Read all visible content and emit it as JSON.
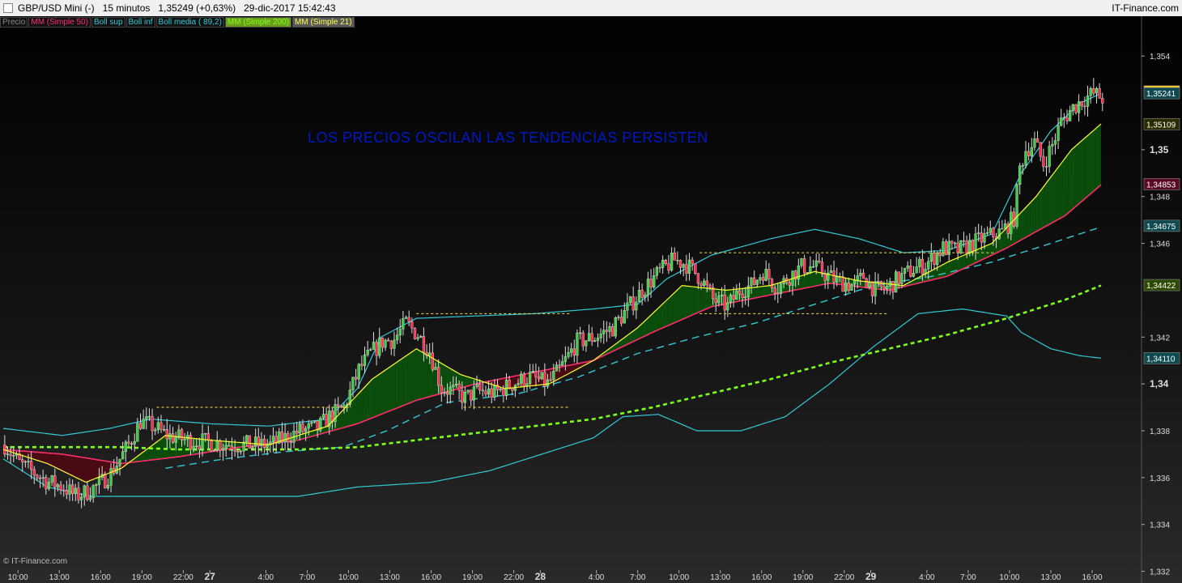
{
  "titlebar": {
    "text": "GBP/USD Mini (-)   15 minutos   1,35249 (+0,63%)   29-dic-2017 15:42:43",
    "brand": "IT-Finance.com"
  },
  "legend": [
    {
      "label": "Precio",
      "color": "#8a8a8a",
      "style": ""
    },
    {
      "label": "MM (Simple 50)",
      "color": "#ff2d7a",
      "style": ""
    },
    {
      "label": "Boll sup",
      "color": "#33c9d6",
      "style": ""
    },
    {
      "label": "Boll inf",
      "color": "#33c9d6",
      "style": ""
    },
    {
      "label": "Boll media ( 89,2)",
      "color": "#33c9d6",
      "style": ""
    },
    {
      "label": "MM (Simple 200)",
      "color": "#7dff1a",
      "style": "hi"
    },
    {
      "label": "MM (Simple 21)",
      "color": "#ffff4d",
      "style": "active"
    }
  ],
  "annotation": "LOS PRECIOS OSCILAN  LAS TENDENCIAS PERSISTEN",
  "watermark": "© IT-Finance.com",
  "chart_data": {
    "type": "candlestick",
    "symbol": "GBP/USD Mini",
    "timeframe": "15 minutos",
    "ylim": [
      1.3315,
      1.3557
    ],
    "x_range_bars": [
      0,
      361
    ],
    "y_ticks": [
      {
        "v": 1.354,
        "label": "1,354",
        "bold": false
      },
      {
        "v": 1.35,
        "label": "1,35",
        "bold": true
      },
      {
        "v": 1.348,
        "label": "1,348",
        "bold": false
      },
      {
        "v": 1.346,
        "label": "1,346",
        "bold": false
      },
      {
        "v": 1.342,
        "label": "1,342",
        "bold": false
      },
      {
        "v": 1.34,
        "label": "1,34",
        "bold": true
      },
      {
        "v": 1.338,
        "label": "1,338",
        "bold": false
      },
      {
        "v": 1.336,
        "label": "1,336",
        "bold": false
      },
      {
        "v": 1.334,
        "label": "1,334",
        "bold": false
      },
      {
        "v": 1.332,
        "label": "1,332",
        "bold": false
      }
    ],
    "x_ticks": [
      {
        "bar": 5,
        "label": "10:00",
        "bold": false
      },
      {
        "bar": 19,
        "label": "13:00",
        "bold": false
      },
      {
        "bar": 33,
        "label": "16:00",
        "bold": false
      },
      {
        "bar": 47,
        "label": "19:00",
        "bold": false
      },
      {
        "bar": 61,
        "label": "22:00",
        "bold": false
      },
      {
        "bar": 70,
        "label": "27",
        "bold": true
      },
      {
        "bar": 89,
        "label": "4:00",
        "bold": false
      },
      {
        "bar": 103,
        "label": "7:00",
        "bold": false
      },
      {
        "bar": 117,
        "label": "10:00",
        "bold": false
      },
      {
        "bar": 131,
        "label": "13:00",
        "bold": false
      },
      {
        "bar": 145,
        "label": "16:00",
        "bold": false
      },
      {
        "bar": 159,
        "label": "19:00",
        "bold": false
      },
      {
        "bar": 173,
        "label": "22:00",
        "bold": false
      },
      {
        "bar": 182,
        "label": "28",
        "bold": true
      },
      {
        "bar": 201,
        "label": "4:00",
        "bold": false
      },
      {
        "bar": 215,
        "label": "7:00",
        "bold": false
      },
      {
        "bar": 229,
        "label": "10:00",
        "bold": false
      },
      {
        "bar": 243,
        "label": "13:00",
        "bold": false
      },
      {
        "bar": 257,
        "label": "16:00",
        "bold": false
      },
      {
        "bar": 271,
        "label": "19:00",
        "bold": false
      },
      {
        "bar": 285,
        "label": "22:00",
        "bold": false
      },
      {
        "bar": 294,
        "label": "29",
        "bold": true
      },
      {
        "bar": 313,
        "label": "4:00",
        "bold": false
      },
      {
        "bar": 327,
        "label": "7:00",
        "bold": false
      },
      {
        "bar": 341,
        "label": "10:00",
        "bold": false
      },
      {
        "bar": 355,
        "label": "13:00",
        "bold": false
      },
      {
        "bar": 369,
        "label": "16:00",
        "bold": false
      }
    ],
    "price_tags": [
      {
        "v": 1.35249,
        "label": "1,35249",
        "bg": "#ffd21f",
        "fg": "#000",
        "note": "last price"
      },
      {
        "v": 1.35241,
        "label": "1,35241",
        "bg": "#0e4a4f",
        "fg": "#fff",
        "note": "Boll sup"
      },
      {
        "v": 1.35109,
        "label": "1,35109",
        "bg": "#2b2b00",
        "fg": "#fff",
        "note": "MM 21"
      },
      {
        "v": 1.34853,
        "label": "1,34853",
        "bg": "#5a0a22",
        "fg": "#fff",
        "note": "MM 50"
      },
      {
        "v": 1.34675,
        "label": "1,34675",
        "bg": "#0e4a4f",
        "fg": "#fff",
        "note": "Boll media"
      },
      {
        "v": 1.34422,
        "label": "1,34422",
        "bg": "#2a4a00",
        "fg": "#fff",
        "note": "MM 200"
      },
      {
        "v": 1.3411,
        "label": "1,34110",
        "bg": "#0e4a4f",
        "fg": "#fff",
        "note": "Boll inf"
      }
    ],
    "price_anchors": [
      [
        0,
        1.3374
      ],
      [
        5,
        1.3366
      ],
      [
        10,
        1.3362
      ],
      [
        15,
        1.3358
      ],
      [
        20,
        1.3356
      ],
      [
        24,
        1.3352
      ],
      [
        28,
        1.3354
      ],
      [
        32,
        1.3357
      ],
      [
        36,
        1.3362
      ],
      [
        42,
        1.3374
      ],
      [
        46,
        1.3384
      ],
      [
        50,
        1.3382
      ],
      [
        55,
        1.3378
      ],
      [
        62,
        1.3376
      ],
      [
        70,
        1.3375
      ],
      [
        78,
        1.3374
      ],
      [
        84,
        1.3374
      ],
      [
        90,
        1.3374
      ],
      [
        95,
        1.3377
      ],
      [
        100,
        1.338
      ],
      [
        106,
        1.3381
      ],
      [
        110,
        1.3386
      ],
      [
        115,
        1.339
      ],
      [
        120,
        1.3406
      ],
      [
        124,
        1.3413
      ],
      [
        128,
        1.3418
      ],
      [
        132,
        1.3419
      ],
      [
        136,
        1.3426
      ],
      [
        140,
        1.3421
      ],
      [
        144,
        1.3414
      ],
      [
        148,
        1.3398
      ],
      [
        152,
        1.3397
      ],
      [
        156,
        1.3394
      ],
      [
        160,
        1.3397
      ],
      [
        166,
        1.3396
      ],
      [
        172,
        1.34
      ],
      [
        178,
        1.3403
      ],
      [
        184,
        1.34
      ],
      [
        188,
        1.3406
      ],
      [
        194,
        1.3418
      ],
      [
        200,
        1.342
      ],
      [
        206,
        1.3424
      ],
      [
        211,
        1.3432
      ],
      [
        216,
        1.344
      ],
      [
        222,
        1.3448
      ],
      [
        227,
        1.3453
      ],
      [
        231,
        1.3451
      ],
      [
        236,
        1.3445
      ],
      [
        240,
        1.3436
      ],
      [
        245,
        1.3433
      ],
      [
        249,
        1.344
      ],
      [
        253,
        1.3442
      ],
      [
        257,
        1.3448
      ],
      [
        262,
        1.3441
      ],
      [
        266,
        1.3446
      ],
      [
        270,
        1.345
      ],
      [
        274,
        1.345
      ],
      [
        278,
        1.3447
      ],
      [
        282,
        1.3444
      ],
      [
        288,
        1.3442
      ],
      [
        291,
        1.3446
      ],
      [
        295,
        1.344
      ],
      [
        299,
        1.3441
      ],
      [
        303,
        1.3445
      ],
      [
        308,
        1.3449
      ],
      [
        312,
        1.3451
      ],
      [
        318,
        1.3458
      ],
      [
        323,
        1.3457
      ],
      [
        328,
        1.346
      ],
      [
        333,
        1.3463
      ],
      [
        338,
        1.3465
      ],
      [
        342,
        1.3471
      ],
      [
        344,
        1.3492
      ],
      [
        346,
        1.35
      ],
      [
        349,
        1.3503
      ],
      [
        352,
        1.3494
      ],
      [
        355,
        1.3502
      ],
      [
        358,
        1.3512
      ],
      [
        362,
        1.3518
      ],
      [
        366,
        1.3522
      ],
      [
        369,
        1.3524
      ],
      [
        372,
        1.3522
      ]
    ],
    "sma50_anchors": [
      [
        0,
        1.3372
      ],
      [
        20,
        1.337
      ],
      [
        40,
        1.3366
      ],
      [
        60,
        1.3369
      ],
      [
        80,
        1.3373
      ],
      [
        100,
        1.3376
      ],
      [
        120,
        1.3383
      ],
      [
        140,
        1.3393
      ],
      [
        160,
        1.34
      ],
      [
        180,
        1.3405
      ],
      [
        200,
        1.341
      ],
      [
        220,
        1.3422
      ],
      [
        240,
        1.3433
      ],
      [
        260,
        1.3438
      ],
      [
        280,
        1.3443
      ],
      [
        300,
        1.344
      ],
      [
        320,
        1.3446
      ],
      [
        340,
        1.3458
      ],
      [
        360,
        1.3472
      ],
      [
        372,
        1.3485
      ]
    ],
    "sma21_anchors": [
      [
        0,
        1.3372
      ],
      [
        15,
        1.3366
      ],
      [
        28,
        1.3358
      ],
      [
        40,
        1.3364
      ],
      [
        55,
        1.3378
      ],
      [
        70,
        1.3376
      ],
      [
        90,
        1.3374
      ],
      [
        110,
        1.3382
      ],
      [
        125,
        1.3402
      ],
      [
        140,
        1.3415
      ],
      [
        155,
        1.3404
      ],
      [
        170,
        1.3398
      ],
      [
        185,
        1.34
      ],
      [
        200,
        1.341
      ],
      [
        215,
        1.3424
      ],
      [
        230,
        1.3442
      ],
      [
        245,
        1.344
      ],
      [
        260,
        1.3442
      ],
      [
        275,
        1.3448
      ],
      [
        290,
        1.3444
      ],
      [
        305,
        1.3442
      ],
      [
        320,
        1.3452
      ],
      [
        335,
        1.346
      ],
      [
        350,
        1.348
      ],
      [
        362,
        1.35
      ],
      [
        372,
        1.3511
      ]
    ],
    "boll_mid_anchors": [
      [
        55,
        1.3364
      ],
      [
        75,
        1.3368
      ],
      [
        95,
        1.3371
      ],
      [
        115,
        1.3373
      ],
      [
        130,
        1.338
      ],
      [
        150,
        1.3392
      ],
      [
        175,
        1.3396
      ],
      [
        195,
        1.3403
      ],
      [
        215,
        1.3413
      ],
      [
        235,
        1.342
      ],
      [
        255,
        1.3426
      ],
      [
        275,
        1.3434
      ],
      [
        295,
        1.3442
      ],
      [
        315,
        1.3446
      ],
      [
        335,
        1.3452
      ],
      [
        355,
        1.346
      ],
      [
        372,
        1.3467
      ]
    ],
    "boll_up_anchors": [
      [
        0,
        1.3381
      ],
      [
        20,
        1.3378
      ],
      [
        36,
        1.3381
      ],
      [
        50,
        1.3385
      ],
      [
        70,
        1.3383
      ],
      [
        90,
        1.3382
      ],
      [
        110,
        1.3385
      ],
      [
        120,
        1.3398
      ],
      [
        128,
        1.342
      ],
      [
        140,
        1.3428
      ],
      [
        160,
        1.3429
      ],
      [
        180,
        1.343
      ],
      [
        200,
        1.3432
      ],
      [
        215,
        1.3434
      ],
      [
        225,
        1.3445
      ],
      [
        240,
        1.3455
      ],
      [
        260,
        1.3462
      ],
      [
        275,
        1.3466
      ],
      [
        290,
        1.3462
      ],
      [
        305,
        1.3456
      ],
      [
        320,
        1.3457
      ],
      [
        335,
        1.3464
      ],
      [
        345,
        1.349
      ],
      [
        355,
        1.3508
      ],
      [
        365,
        1.352
      ],
      [
        372,
        1.3524
      ]
    ],
    "boll_low_anchors": [
      [
        0,
        1.3368
      ],
      [
        15,
        1.3356
      ],
      [
        30,
        1.3352
      ],
      [
        50,
        1.3352
      ],
      [
        80,
        1.3352
      ],
      [
        100,
        1.3352
      ],
      [
        120,
        1.3356
      ],
      [
        145,
        1.3358
      ],
      [
        165,
        1.3363
      ],
      [
        185,
        1.3371
      ],
      [
        200,
        1.3377
      ],
      [
        210,
        1.3386
      ],
      [
        222,
        1.3387
      ],
      [
        235,
        1.338
      ],
      [
        250,
        1.338
      ],
      [
        265,
        1.3386
      ],
      [
        280,
        1.34
      ],
      [
        295,
        1.3416
      ],
      [
        310,
        1.343
      ],
      [
        325,
        1.3432
      ],
      [
        340,
        1.3429
      ],
      [
        345,
        1.3422
      ],
      [
        355,
        1.3415
      ],
      [
        365,
        1.3412
      ],
      [
        372,
        1.3411
      ]
    ],
    "sma200_anchors": [
      [
        0,
        1.3373
      ],
      [
        20,
        1.3373
      ],
      [
        40,
        1.3373
      ],
      [
        60,
        1.3372
      ],
      [
        80,
        1.3372
      ],
      [
        100,
        1.3372
      ],
      [
        120,
        1.3373
      ],
      [
        140,
        1.3376
      ],
      [
        160,
        1.3379
      ],
      [
        180,
        1.3382
      ],
      [
        200,
        1.3385
      ],
      [
        220,
        1.339
      ],
      [
        240,
        1.3396
      ],
      [
        260,
        1.3402
      ],
      [
        280,
        1.3409
      ],
      [
        300,
        1.3415
      ],
      [
        320,
        1.3421
      ],
      [
        340,
        1.3428
      ],
      [
        360,
        1.3436
      ],
      [
        372,
        1.3442
      ]
    ],
    "support_lines": [
      {
        "x1": 52,
        "x2": 118,
        "v": 1.339
      },
      {
        "x1": 140,
        "x2": 192,
        "v": 1.343
      },
      {
        "x1": 156,
        "x2": 192,
        "v": 1.339
      },
      {
        "x1": 236,
        "x2": 336,
        "v": 1.3456
      },
      {
        "x1": 236,
        "x2": 300,
        "v": 1.343
      }
    ],
    "colors": {
      "bull": "#3ad23a",
      "bear": "#ff2a4a",
      "wick": "#dddddd",
      "sma21": "#ffff33",
      "sma50": "#ff2d6e",
      "sma200": "#7dff1a",
      "boll": "#33c9d6",
      "fill_up": "#0b4d0b",
      "fill_down": "#4a0a12",
      "guides": "#ffe24d"
    }
  }
}
